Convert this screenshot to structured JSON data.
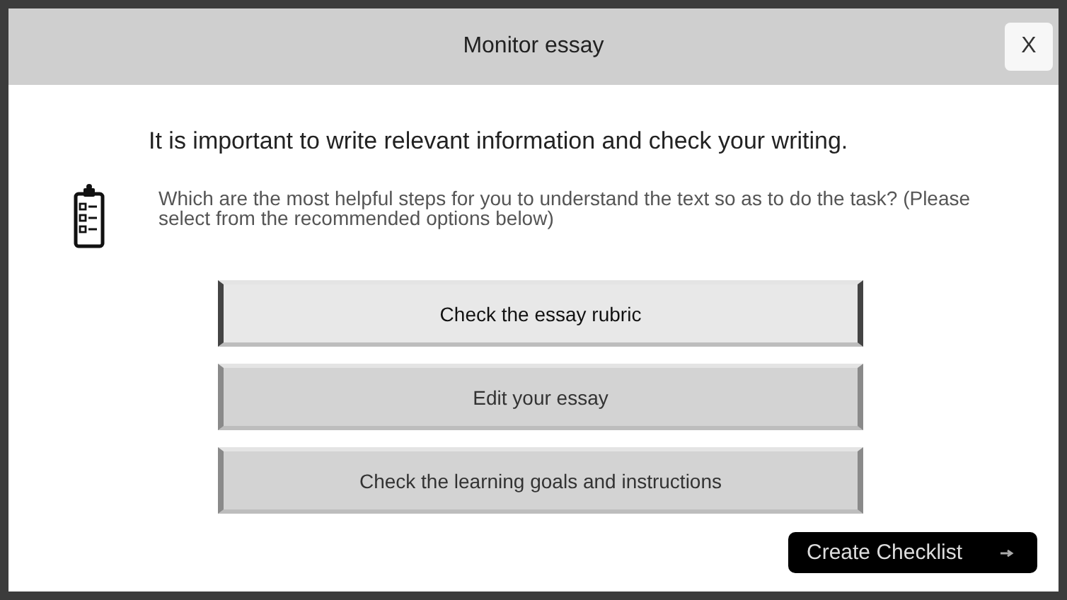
{
  "window": {
    "title": "Monitor essay",
    "close": "X"
  },
  "intro": "It is important to write relevant information and check your writing.",
  "question": "Which are the most helpful steps for you to understand the text so as to do the task? (Please select from the recommended options below)",
  "options": [
    {
      "label": "Check the essay rubric",
      "selected": true
    },
    {
      "label": "Edit your essay",
      "selected": false
    },
    {
      "label": "Check the learning goals and instructions",
      "selected": false
    }
  ],
  "action": {
    "label": "Create Checklist"
  }
}
